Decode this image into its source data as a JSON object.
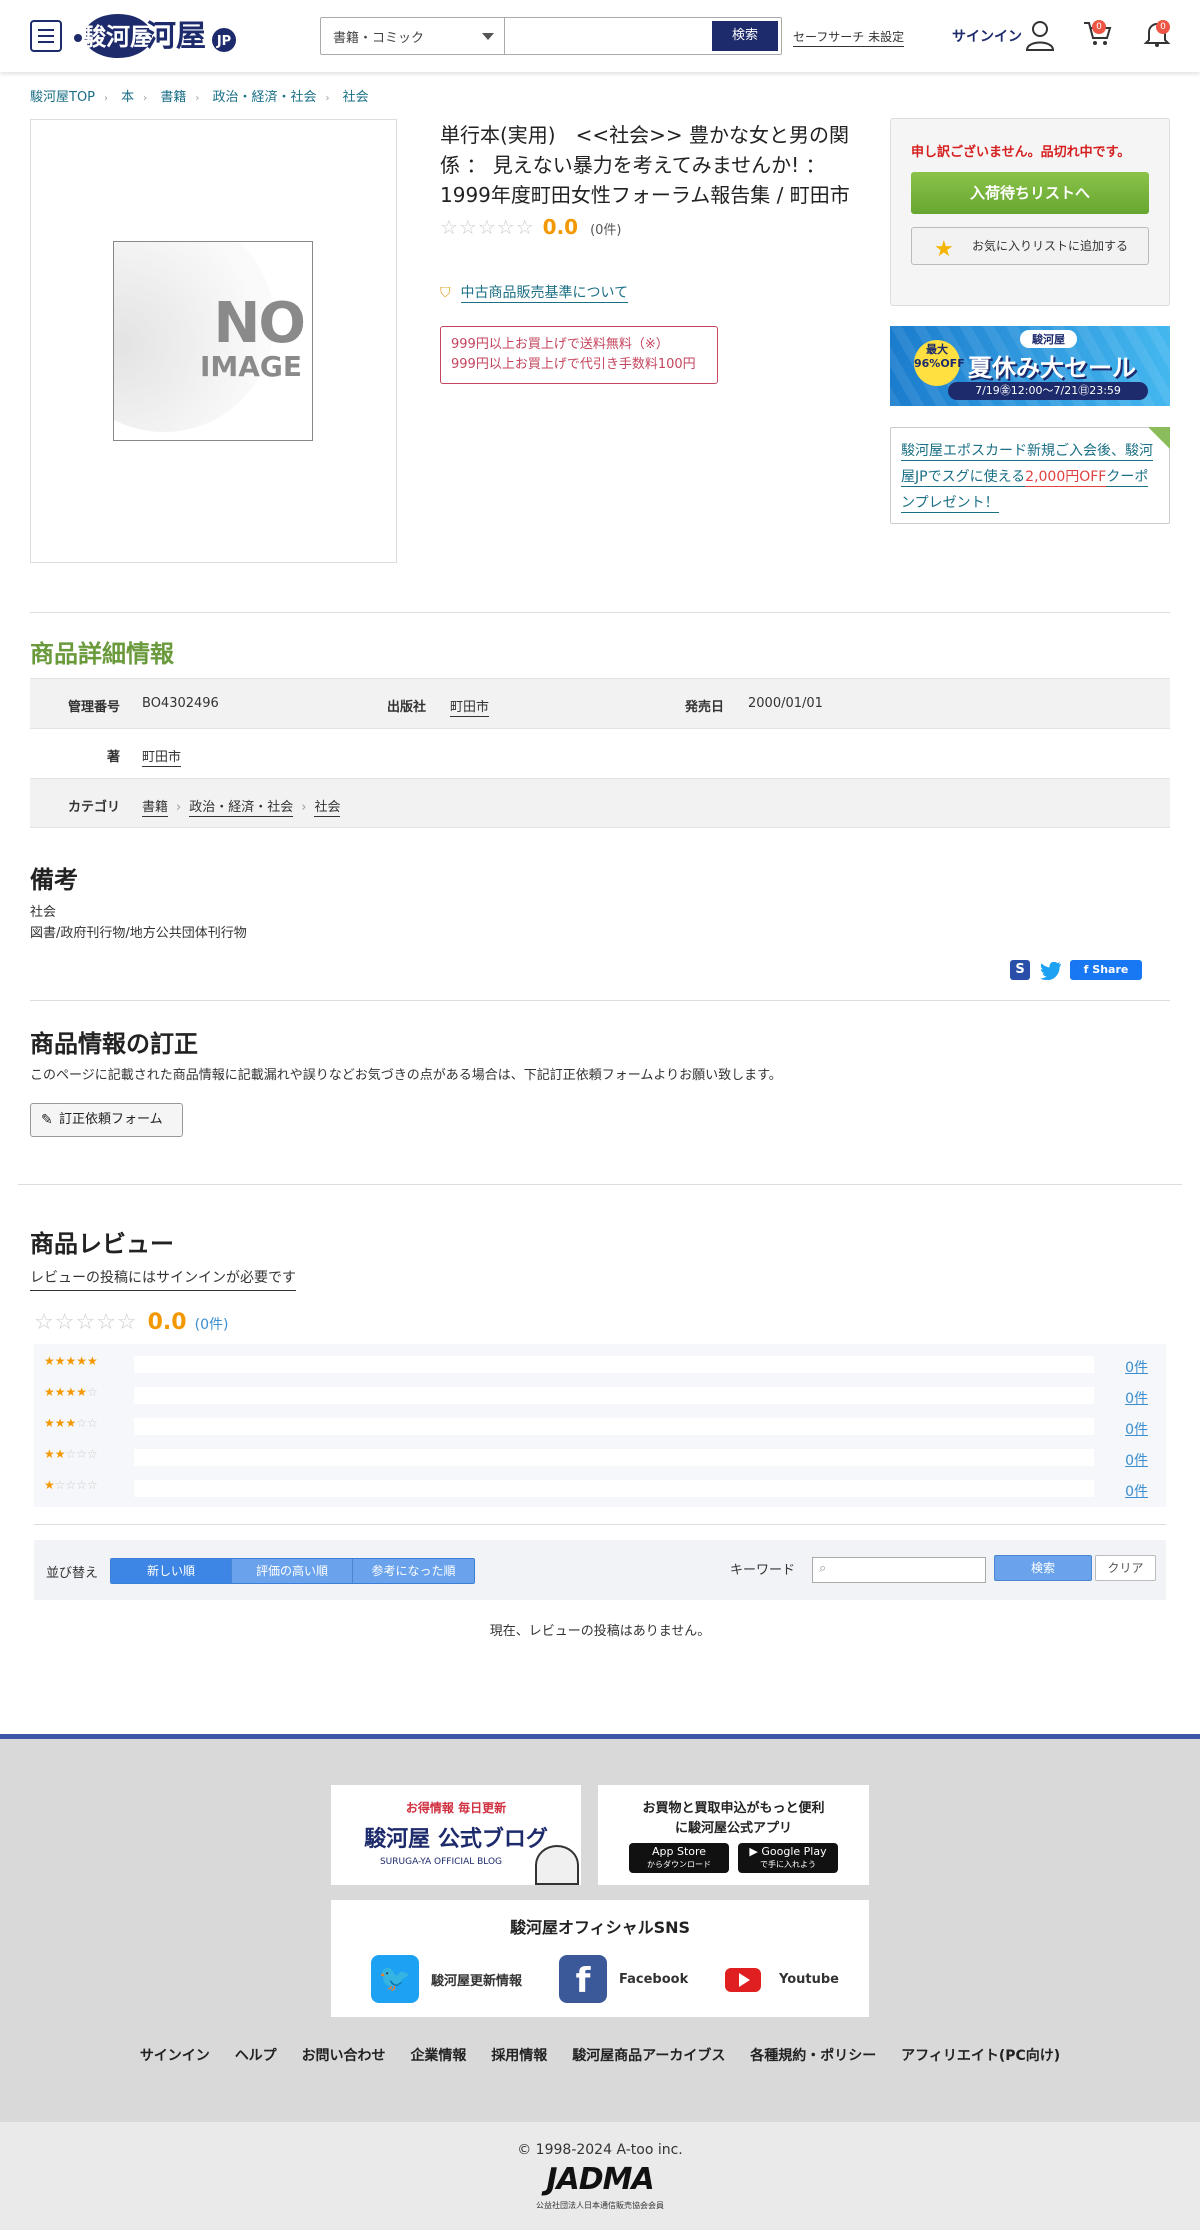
{
  "header": {
    "logo_text": "駿河屋",
    "logo_badge": "JP",
    "search_category": "書籍・コミック",
    "search_placeholder": "",
    "search_button": "検索",
    "safe_search": "セーフサーチ 未設定",
    "signin": "サインイン",
    "cart_count": "0",
    "notice_count": "0"
  },
  "breadcrumb": [
    "駿河屋TOP",
    "本",
    "書籍",
    "政治・経済・社会",
    "社会"
  ],
  "product": {
    "title": "単行本(実用)　<<社会>> 豊かな女と男の関係 ： 見えない暴力を考えてみませんか! ： 1999年度町田女性フォーラム報告集 / 町田市",
    "rating": "0.0",
    "review_count": "(0件)",
    "no_image_line1": "NO",
    "no_image_line2": "IMAGE",
    "used_standard_link": "中古商品販売基準について",
    "shipping_line1": "999円以上お買上げで送料無料（※）",
    "shipping_line2": "999円以上お買上げで代引き手数料100円"
  },
  "sidebar": {
    "soldout": "申し訳ございません。品切れ中です。",
    "waitlist_button": "入荷待ちリストへ",
    "favorite_button": "お気に入りリストに追加する",
    "banner_top": "駿河屋",
    "banner_percent": "最大96%OFF",
    "banner_title": "夏休み大セール",
    "banner_dates": "7/19㊎12:00～7/21㊐23:59",
    "epos_text1": "駿河屋エポスカード新規ご入会後、駿河屋JPでスグに使える",
    "epos_highlight": "2,000円OFF",
    "epos_text2": "クーポンプレゼント！"
  },
  "details": {
    "heading": "商品詳細情報",
    "id_label": "管理番号",
    "id_value": "BO4302496",
    "publisher_label": "出版社",
    "publisher_value": "町田市",
    "release_label": "発売日",
    "release_value": "2000/01/01",
    "author_label": "著",
    "author_value": "町田市",
    "category_label": "カテゴリ",
    "categories": [
      "書籍",
      "政治・経済・社会",
      "社会"
    ]
  },
  "notes": {
    "heading": "備考",
    "line1": "社会",
    "line2": "図書/政府刊行物/地方公共団体刊行物",
    "share_label": "Share"
  },
  "correction": {
    "heading": "商品情報の訂正",
    "text": "このページに記載された商品情報に記載漏れや誤りなどお気づきの点がある場合は、下記訂正依頼フォームよりお願い致します。",
    "button": "訂正依頼フォーム"
  },
  "reviews": {
    "heading": "商品レビュー",
    "signin_link": "レビューの投稿にはサインインが必要です",
    "rating": "0.0",
    "count": "0件",
    "rows": [
      {
        "stars": 5,
        "count": "0件"
      },
      {
        "stars": 4,
        "count": "0件"
      },
      {
        "stars": 3,
        "count": "0件"
      },
      {
        "stars": 2,
        "count": "0件"
      },
      {
        "stars": 1,
        "count": "0件"
      }
    ],
    "sort_label": "並び替え",
    "sort_options": [
      "新しい順",
      "評価の高い順",
      "参考になった順"
    ],
    "keyword_label": "キーワード",
    "search_button": "検索",
    "clear_button": "クリア",
    "empty": "現在、レビューの投稿はありません。"
  },
  "footer": {
    "blog_tag": "お得情報 毎日更新",
    "blog_title": "駿河屋 公式ブログ",
    "blog_sub": "SURUGA-YA OFFICIAL BLOG",
    "app_line1": "お買物と買取申込がもっと便利",
    "app_line2": "に駿河屋公式アプリ",
    "appstore_top": "App Store",
    "appstore_sub": "からダウンロード",
    "gplay_top": "Google Play",
    "gplay_sub": "で手に入れよう",
    "sns_title": "駿河屋オフィシャルSNS",
    "twitter": "駿河屋更新情報",
    "facebook": "Facebook",
    "youtube": "Youtube",
    "links": [
      "サインイン",
      "ヘルプ",
      "お問い合わせ",
      "企業情報",
      "採用情報",
      "駿河屋商品アーカイブス",
      "各種規約・ポリシー",
      "アフィリエイト(PC向け)"
    ],
    "copyright": "© 1998-2024 A-too inc.",
    "jadma": "JADMA",
    "jadma_sub": "公益社団法人日本通信販売協会会員"
  }
}
